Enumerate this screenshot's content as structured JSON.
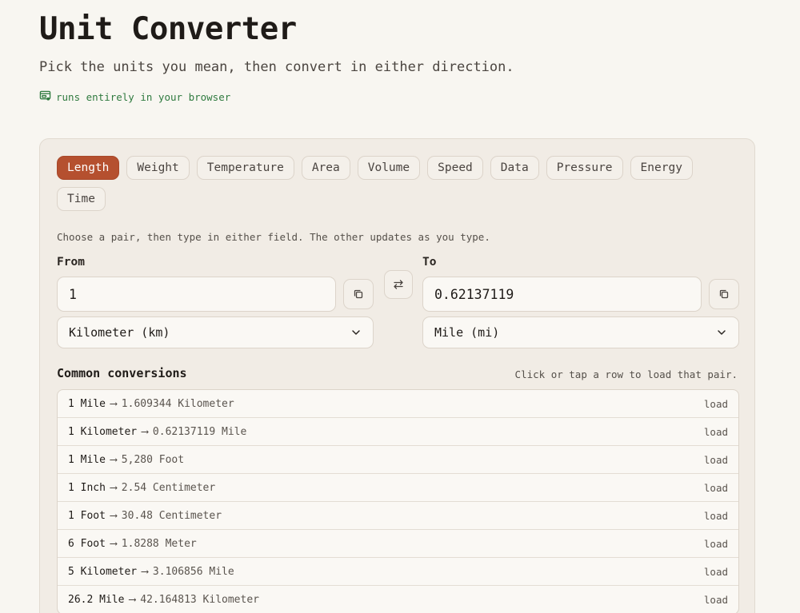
{
  "header": {
    "title": "Unit Converter",
    "subtitle": "Pick the units you mean, then convert in either direction.",
    "badge": "runs entirely in your browser"
  },
  "tabs": [
    {
      "label": "Length",
      "active": true
    },
    {
      "label": "Weight",
      "active": false
    },
    {
      "label": "Temperature",
      "active": false
    },
    {
      "label": "Area",
      "active": false
    },
    {
      "label": "Volume",
      "active": false
    },
    {
      "label": "Speed",
      "active": false
    },
    {
      "label": "Data",
      "active": false
    },
    {
      "label": "Pressure",
      "active": false
    },
    {
      "label": "Energy",
      "active": false
    },
    {
      "label": "Time",
      "active": false
    }
  ],
  "converter": {
    "hint": "Choose a pair, then type in either field. The other updates as you type.",
    "from_label": "From",
    "to_label": "To",
    "from_value": "1",
    "to_value": "0.62137119",
    "from_unit": "Kilometer (km)",
    "to_unit": "Mile (mi)"
  },
  "common": {
    "title": "Common conversions",
    "hint": "Click or tap a row to load that pair.",
    "arrow": "⟶",
    "load_label": "load",
    "rows": [
      {
        "from": "1 Mile",
        "to": "1.609344 Kilometer"
      },
      {
        "from": "1 Kilometer",
        "to": "0.62137119 Mile"
      },
      {
        "from": "1 Mile",
        "to": "5,280 Foot"
      },
      {
        "from": "1 Inch",
        "to": "2.54 Centimeter"
      },
      {
        "from": "1 Foot",
        "to": "30.48 Centimeter"
      },
      {
        "from": "6 Foot",
        "to": "1.8288 Meter"
      },
      {
        "from": "5 Kilometer",
        "to": "3.106856 Mile"
      },
      {
        "from": "26.2 Mile",
        "to": "42.164813 Kilometer"
      }
    ]
  },
  "colors": {
    "accent": "#b5502f",
    "badge": "#2f7a3f",
    "background": "#f8f6f1",
    "card": "#f1ece5"
  }
}
